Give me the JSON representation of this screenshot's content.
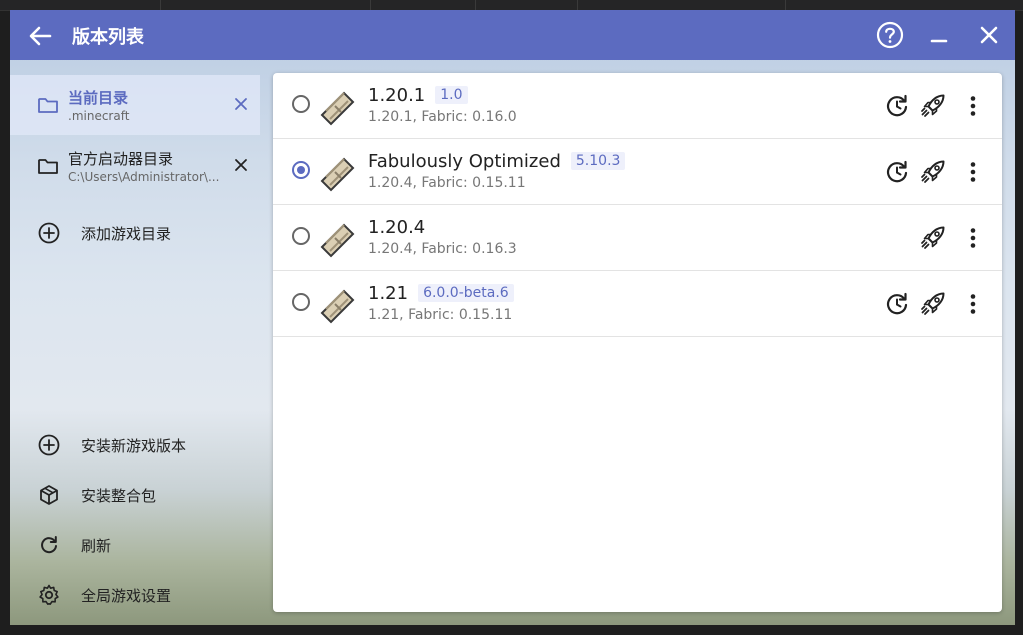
{
  "window": {
    "title": "版本列表"
  },
  "titlebar": {
    "back_icon": "arrow-left-icon",
    "help_icon": "help-circle-icon",
    "minimize_icon": "minimize-icon",
    "close_icon": "close-icon"
  },
  "sidebar": {
    "directories": [
      {
        "title": "当前目录",
        "path": ".minecraft",
        "active": true
      },
      {
        "title": "官方启动器目录",
        "path": "C:\\Users\\Administrator\\...",
        "active": false
      }
    ],
    "add_dir_label": "添加游戏目录",
    "actions": [
      {
        "label": "安装新游戏版本",
        "icon": "plus-circle-icon"
      },
      {
        "label": "安装整合包",
        "icon": "package-icon"
      },
      {
        "label": "刷新",
        "icon": "refresh-icon"
      },
      {
        "label": "全局游戏设置",
        "icon": "gear-icon"
      }
    ]
  },
  "versions": [
    {
      "name": "1.20.1",
      "tag": "1.0",
      "detail": "1.20.1, Fabric: 0.16.0",
      "selected": false,
      "has_update": true
    },
    {
      "name": "Fabulously Optimized",
      "tag": "5.10.3",
      "detail": "1.20.4, Fabric: 0.15.11",
      "selected": true,
      "has_update": true
    },
    {
      "name": "1.20.4",
      "tag": "",
      "detail": "1.20.4, Fabric: 0.16.3",
      "selected": false,
      "has_update": false
    },
    {
      "name": "1.21",
      "tag": "6.0.0-beta.6",
      "detail": "1.21, Fabric: 0.15.11",
      "selected": false,
      "has_update": true
    }
  ],
  "colors": {
    "accent": "#5c6bc0"
  }
}
